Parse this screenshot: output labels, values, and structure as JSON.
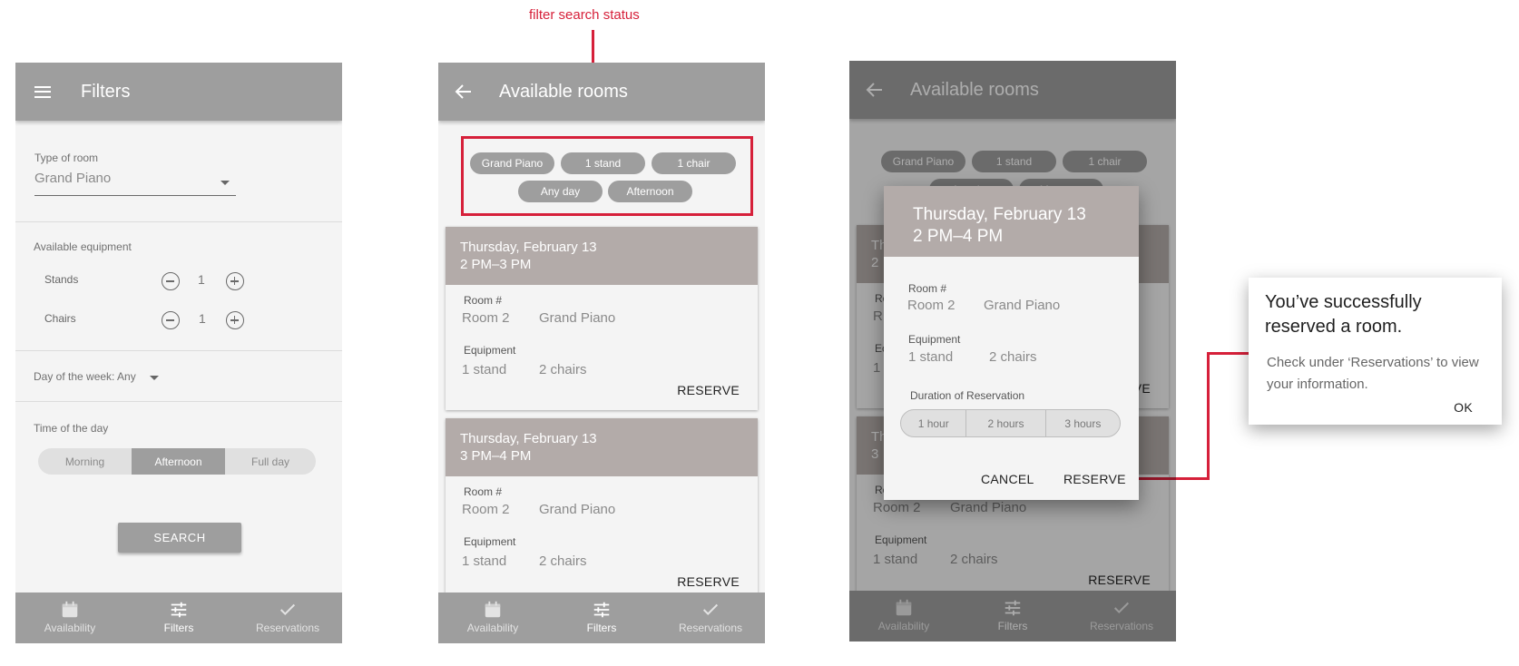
{
  "annotation": {
    "filter_label": "filter search status"
  },
  "filters_screen": {
    "title": "Filters",
    "type_of_room": {
      "label": "Type of room",
      "value": "Grand Piano"
    },
    "equipment": {
      "label": "Available equipment",
      "stands": {
        "label": "Stands",
        "value": "1"
      },
      "chairs": {
        "label": "Chairs",
        "value": "1"
      }
    },
    "day_of_week": "Day of the week: Any",
    "time_of_day": {
      "label": "Time of the day",
      "options": [
        "Morning",
        "Afternoon",
        "Full day"
      ],
      "selected": "Afternoon"
    },
    "search_label": "SEARCH"
  },
  "rooms_screen": {
    "title": "Available rooms",
    "chips": [
      "Grand Piano",
      "1 stand",
      "1 chair",
      "Any day",
      "Afternoon"
    ],
    "cards": [
      {
        "date": "Thursday, February 13",
        "time": "2 PM–3 PM",
        "room_label": "Room #",
        "room": "Room 2",
        "room_type": "Grand Piano",
        "equipment_label": "Equipment",
        "stands": "1 stand",
        "chairs": "2 chairs",
        "action": "RESERVE"
      },
      {
        "date": "Thursday, February 13",
        "time": "3 PM–4 PM",
        "room_label": "Room #",
        "room": "Room 2",
        "room_type": "Grand Piano",
        "equipment_label": "Equipment",
        "stands": "1 stand",
        "chairs": "2 chairs",
        "action": "RESERVE"
      }
    ]
  },
  "background_cards": {
    "card1_head_frag": "Th",
    "card1_time_frag": "2",
    "card1_room_frag": "Ro",
    "card1_room_value_frag": "R",
    "card1_eq_frag": "Ec",
    "card1_stand_frag": "1",
    "card1_action_frag": "VE",
    "card2_head_frag": "Th",
    "card2_time_frag": "3",
    "card2_room_frag": "Ro",
    "card2_room": "Room 2",
    "card2_room_type": "Grand Piano",
    "card2_eq": "Equipment",
    "card2_stands": "1 stand",
    "card2_chairs": "2 chairs",
    "card2_action": "RESERVE"
  },
  "dialog": {
    "date": "Thursday, February 13",
    "time": "2 PM–4 PM",
    "room_label": "Room #",
    "room": "Room 2",
    "room_type": "Grand Piano",
    "equipment_label": "Equipment",
    "stands": "1 stand",
    "chairs": "2 chairs",
    "duration_label": "Duration of Reservation",
    "durations": [
      "1 hour",
      "2 hours",
      "3 hours"
    ],
    "cancel": "CANCEL",
    "reserve": "RESERVE"
  },
  "toast": {
    "title": "You’ve successfully reserved a room.",
    "body": "Check under ‘Reservations’ to view your information.",
    "ok": "OK"
  },
  "bottom_nav": [
    "Availability",
    "Filters",
    "Reservations"
  ],
  "colors": {
    "app_bar": "#9e9e9e",
    "card_header": "#b3aba9",
    "annotation_red": "#d6203a",
    "background": "#f4f4f4"
  }
}
